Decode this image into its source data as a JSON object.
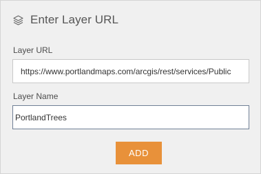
{
  "header": {
    "title": "Enter Layer URL",
    "icon": "layers-icon"
  },
  "url_field": {
    "label": "Layer URL",
    "value": "https://www.portlandmaps.com/arcgis/rest/services/Public"
  },
  "name_field": {
    "label": "Layer Name",
    "value": "PortlandTrees"
  },
  "add_button": {
    "label": "ADD",
    "color": "#e8913a"
  }
}
